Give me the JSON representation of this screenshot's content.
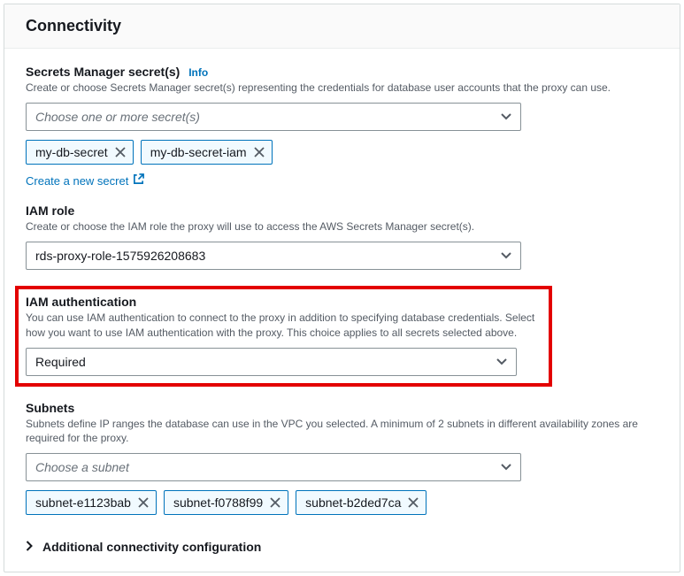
{
  "panel": {
    "title": "Connectivity"
  },
  "secrets": {
    "label": "Secrets Manager secret(s)",
    "info": "Info",
    "desc": "Create or choose Secrets Manager secret(s) representing the credentials for database user accounts that the proxy can use.",
    "placeholder": "Choose one or more secret(s)",
    "tokens": [
      "my-db-secret",
      "my-db-secret-iam"
    ],
    "createLink": "Create a new secret"
  },
  "iamRole": {
    "label": "IAM role",
    "desc": "Create or choose the IAM role the proxy will use to access the AWS Secrets Manager secret(s).",
    "value": "rds-proxy-role-1575926208683"
  },
  "iamAuth": {
    "label": "IAM authentication",
    "desc": "You can use IAM authentication to connect to the proxy in addition to specifying database credentials. Select how you want to use IAM authentication with the proxy. This choice applies to all secrets selected above.",
    "value": "Required"
  },
  "subnets": {
    "label": "Subnets",
    "desc": "Subnets define IP ranges the database can use in the VPC you selected. A minimum of 2 subnets in different availability zones are required for the proxy.",
    "placeholder": "Choose a subnet",
    "tokens": [
      "subnet-e1123bab",
      "subnet-f0788f99",
      "subnet-b2ded7ca"
    ]
  },
  "expand": {
    "label": "Additional connectivity configuration"
  }
}
